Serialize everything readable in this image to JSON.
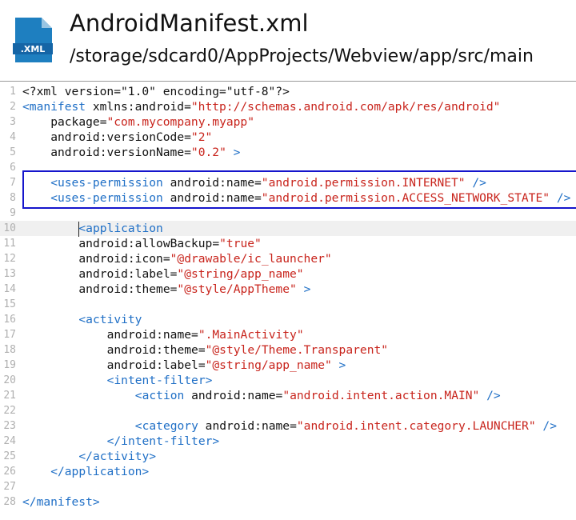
{
  "header": {
    "icon_label": ".XML",
    "file_name": "AndroidManifest.xml",
    "file_path": "/storage/sdcard0/AppProjects/Webview/app/src/main"
  },
  "colors": {
    "tag": "#1f6fc6",
    "value": "#c8241c",
    "icon": "#1e7fc0",
    "selection": "#1515cc"
  },
  "editor": {
    "current_line": 10,
    "selection_lines": [
      7,
      8
    ],
    "lines": [
      {
        "num": "1",
        "indent": 0,
        "tokens": [
          {
            "t": "p",
            "v": "<?xml version=\"1.0\" encoding=\"utf-8\"?>"
          }
        ]
      },
      {
        "num": "2",
        "indent": 0,
        "tokens": [
          {
            "t": "tag",
            "v": "<manifest"
          },
          {
            "t": "p",
            "v": " xmlns:android="
          },
          {
            "t": "val",
            "v": "\"http://schemas.android.com/apk/res/android\""
          }
        ]
      },
      {
        "num": "3",
        "indent": 1,
        "tokens": [
          {
            "t": "p",
            "v": "package="
          },
          {
            "t": "val",
            "v": "\"com.mycompany.myapp\""
          }
        ]
      },
      {
        "num": "4",
        "indent": 1,
        "tokens": [
          {
            "t": "p",
            "v": "android:versionCode="
          },
          {
            "t": "val",
            "v": "\"2\""
          }
        ]
      },
      {
        "num": "5",
        "indent": 1,
        "tokens": [
          {
            "t": "p",
            "v": "android:versionName="
          },
          {
            "t": "val",
            "v": "\"0.2\""
          },
          {
            "t": "tag",
            "v": " >"
          }
        ]
      },
      {
        "num": "6",
        "indent": 0,
        "tokens": []
      },
      {
        "num": "7",
        "indent": 1,
        "tokens": [
          {
            "t": "tag",
            "v": "<uses-permission"
          },
          {
            "t": "p",
            "v": " android:name="
          },
          {
            "t": "val",
            "v": "\"android.permission.INTERNET\""
          },
          {
            "t": "tag",
            "v": " />"
          }
        ]
      },
      {
        "num": "8",
        "indent": 1,
        "tokens": [
          {
            "t": "tag",
            "v": "<uses-permission"
          },
          {
            "t": "p",
            "v": " android:name="
          },
          {
            "t": "val",
            "v": "\"android.permission.ACCESS_NETWORK_STATE\""
          },
          {
            "t": "tag",
            "v": " />"
          }
        ]
      },
      {
        "num": "9",
        "indent": 0,
        "tokens": []
      },
      {
        "num": "10",
        "indent": 2,
        "tokens": [
          {
            "t": "tag",
            "v": "<application"
          }
        ]
      },
      {
        "num": "11",
        "indent": 2,
        "tokens": [
          {
            "t": "p",
            "v": "android:allowBackup="
          },
          {
            "t": "val",
            "v": "\"true\""
          }
        ]
      },
      {
        "num": "12",
        "indent": 2,
        "tokens": [
          {
            "t": "p",
            "v": "android:icon="
          },
          {
            "t": "val",
            "v": "\"@drawable/ic_launcher\""
          }
        ]
      },
      {
        "num": "13",
        "indent": 2,
        "tokens": [
          {
            "t": "p",
            "v": "android:label="
          },
          {
            "t": "val",
            "v": "\"@string/app_name\""
          }
        ]
      },
      {
        "num": "14",
        "indent": 2,
        "tokens": [
          {
            "t": "p",
            "v": "android:theme="
          },
          {
            "t": "val",
            "v": "\"@style/AppTheme\""
          },
          {
            "t": "tag",
            "v": " >"
          }
        ]
      },
      {
        "num": "15",
        "indent": 0,
        "tokens": []
      },
      {
        "num": "16",
        "indent": 2,
        "tokens": [
          {
            "t": "tag",
            "v": "<activity"
          }
        ]
      },
      {
        "num": "17",
        "indent": 3,
        "tokens": [
          {
            "t": "p",
            "v": "android:name="
          },
          {
            "t": "val",
            "v": "\".MainActivity\""
          }
        ]
      },
      {
        "num": "18",
        "indent": 3,
        "tokens": [
          {
            "t": "p",
            "v": "android:theme="
          },
          {
            "t": "val",
            "v": "\"@style/Theme.Transparent\""
          }
        ]
      },
      {
        "num": "19",
        "indent": 3,
        "tokens": [
          {
            "t": "p",
            "v": "android:label="
          },
          {
            "t": "val",
            "v": "\"@string/app_name\""
          },
          {
            "t": "tag",
            "v": " >"
          }
        ]
      },
      {
        "num": "20",
        "indent": 3,
        "tokens": [
          {
            "t": "tag",
            "v": "<intent-filter>"
          }
        ]
      },
      {
        "num": "21",
        "indent": 4,
        "tokens": [
          {
            "t": "tag",
            "v": "<action"
          },
          {
            "t": "p",
            "v": " android:name="
          },
          {
            "t": "val",
            "v": "\"android.intent.action.MAIN\""
          },
          {
            "t": "tag",
            "v": " />"
          }
        ]
      },
      {
        "num": "22",
        "indent": 0,
        "tokens": []
      },
      {
        "num": "23",
        "indent": 4,
        "tokens": [
          {
            "t": "tag",
            "v": "<category"
          },
          {
            "t": "p",
            "v": " android:name="
          },
          {
            "t": "val",
            "v": "\"android.intent.category.LAUNCHER\""
          },
          {
            "t": "tag",
            "v": " />"
          }
        ]
      },
      {
        "num": "24",
        "indent": 3,
        "tokens": [
          {
            "t": "tag",
            "v": "</intent-filter>"
          }
        ]
      },
      {
        "num": "25",
        "indent": 2,
        "tokens": [
          {
            "t": "tag",
            "v": "</activity>"
          }
        ]
      },
      {
        "num": "26",
        "indent": 1,
        "tokens": [
          {
            "t": "tag",
            "v": "</application>"
          }
        ]
      },
      {
        "num": "27",
        "indent": 0,
        "tokens": []
      },
      {
        "num": "28",
        "indent": 0,
        "tokens": [
          {
            "t": "tag",
            "v": "</manifest>"
          }
        ]
      }
    ]
  }
}
